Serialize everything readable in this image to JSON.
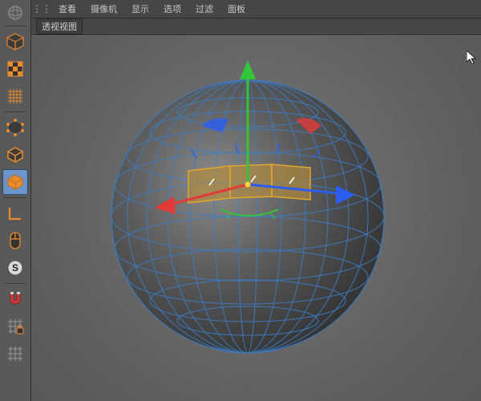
{
  "menubar": {
    "items": [
      "查看",
      "摄像机",
      "显示",
      "选项",
      "过滤",
      "面板"
    ]
  },
  "subbar": {
    "view_label": "透视视图"
  },
  "toolbar": {
    "items": [
      {
        "name": "globe-icon",
        "label": "world"
      },
      {
        "name": "cube-icon",
        "label": "model"
      },
      {
        "name": "checker-icon",
        "label": "texture"
      },
      {
        "name": "grid-icon",
        "label": "grid"
      },
      {
        "name": "point-mode-icon",
        "label": "points"
      },
      {
        "name": "edge-mode-icon",
        "label": "edges"
      },
      {
        "name": "poly-mode-icon",
        "label": "polygons",
        "active": true
      },
      {
        "name": "axis-icon",
        "label": "axis-L"
      },
      {
        "name": "mouse-icon",
        "label": "tweak"
      },
      {
        "name": "s-circle-icon",
        "label": "soft-select"
      },
      {
        "name": "magnet-icon",
        "label": "snap"
      },
      {
        "name": "grid-lock-icon",
        "label": "grid-lock"
      },
      {
        "name": "grid-b-icon",
        "label": "grid-b"
      }
    ]
  },
  "scene": {
    "object": "sphere",
    "wireframe_color": "#3a7ec8",
    "selection_color": "#e2a52e",
    "axis_x_color": "#e23a3a",
    "axis_y_color": "#34c43a",
    "axis_z_color": "#2a5df0",
    "selected_faces": 3
  }
}
